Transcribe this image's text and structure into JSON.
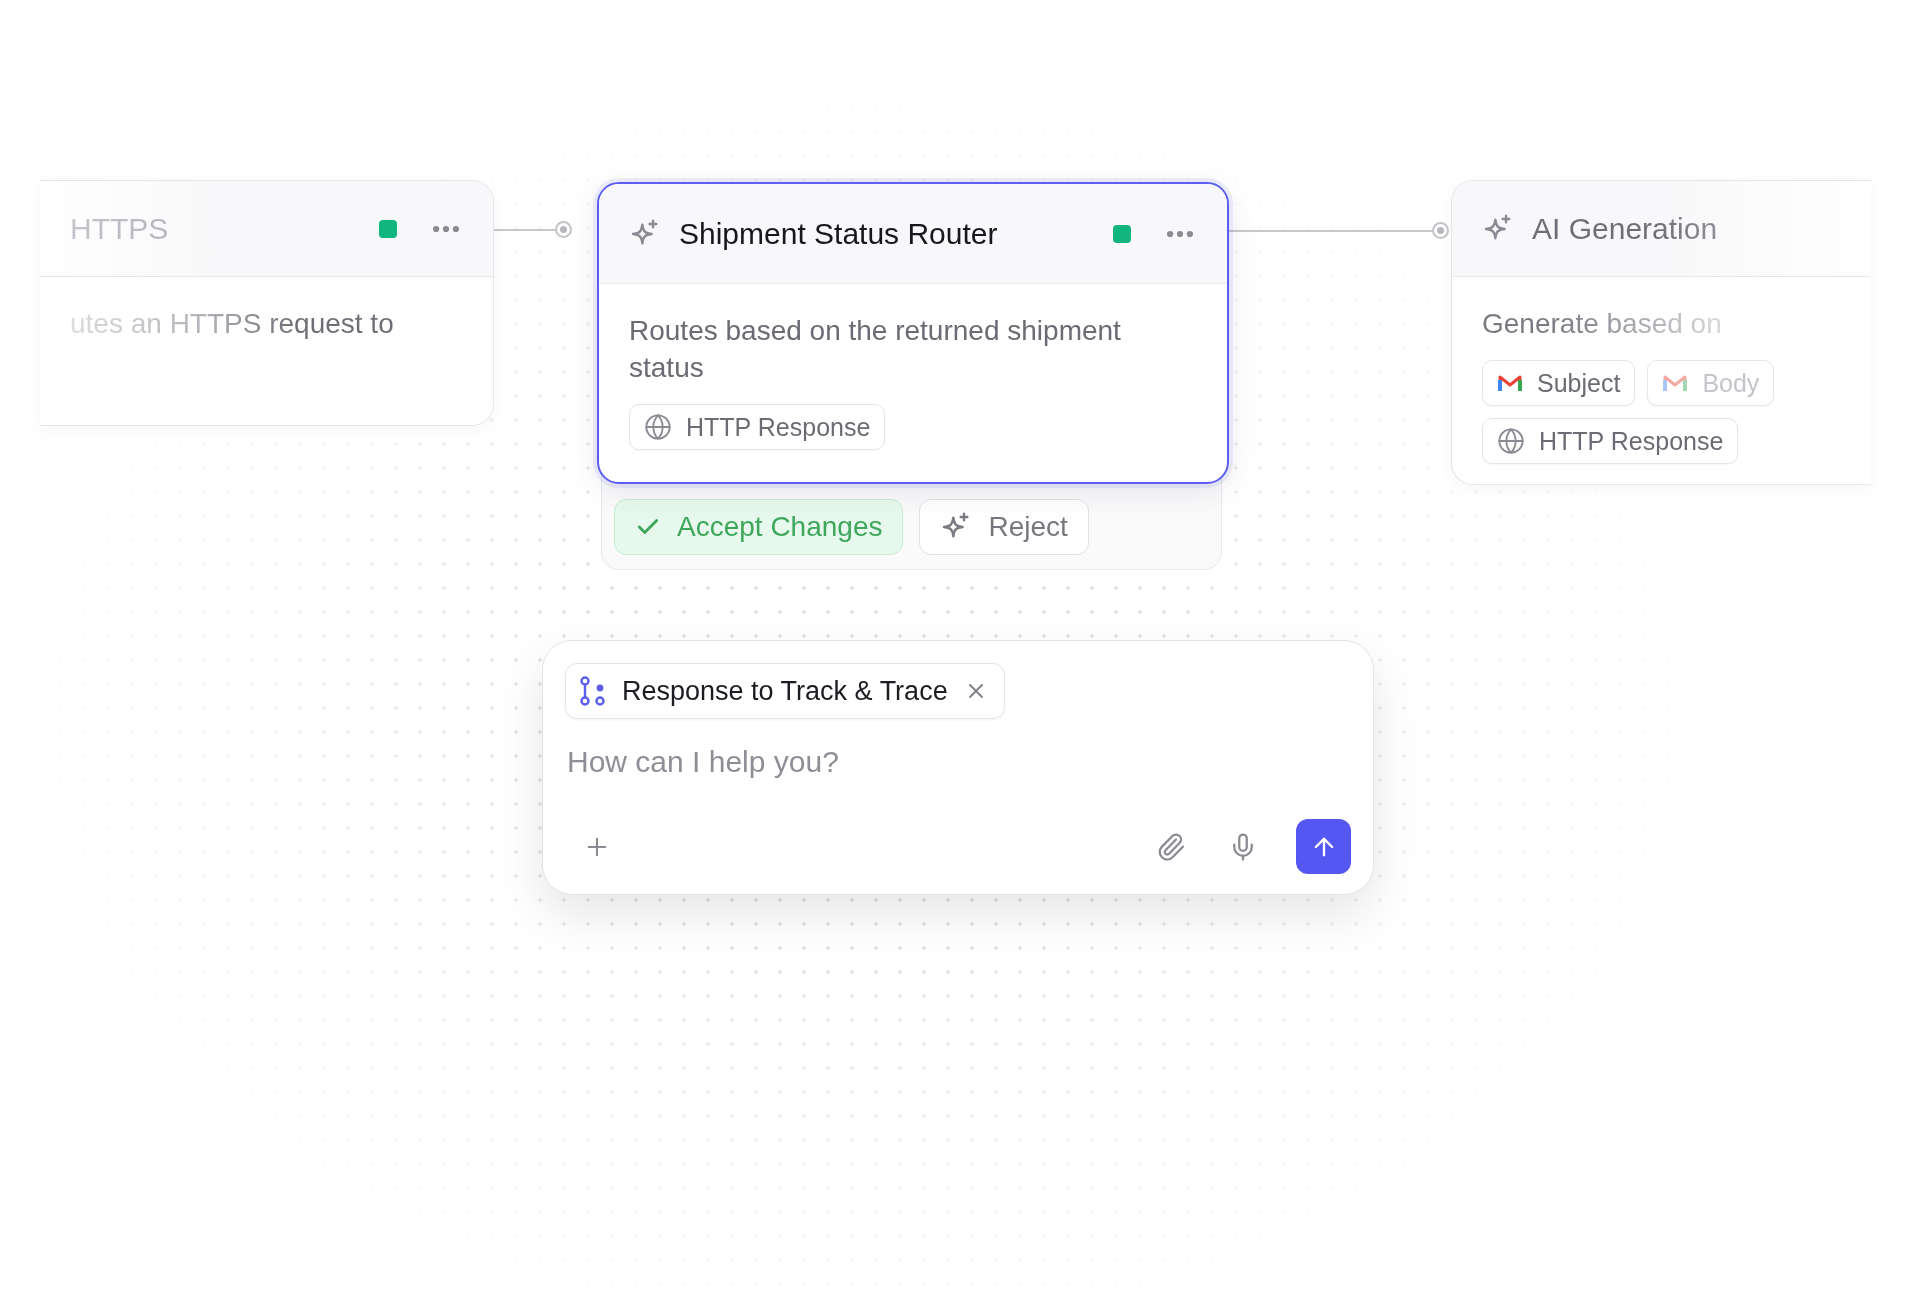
{
  "nodes": [
    {
      "kind": "side",
      "title": "HTTPS",
      "active": true,
      "description": "utes an HTTPS request to"
    },
    {
      "kind": "main",
      "selected": true,
      "title": "Shipment Status Router",
      "active": true,
      "description": "Routes based on the returned shipment status",
      "chips": [
        {
          "label": "HTTP Response"
        }
      ],
      "actions": [
        {
          "kind": "accept",
          "label": "Accept Changes"
        },
        {
          "kind": "reject",
          "label": "Reject"
        }
      ]
    },
    {
      "kind": "side-right",
      "title": "AI Generation",
      "description": "Generate based on",
      "chips": [
        {
          "label": "Subject"
        },
        {
          "label": "Body"
        },
        {
          "label": "HTTP Response"
        }
      ]
    }
  ],
  "chat": {
    "context_chip": "Response to Track & Trace",
    "placeholder": "How can I help you?"
  }
}
